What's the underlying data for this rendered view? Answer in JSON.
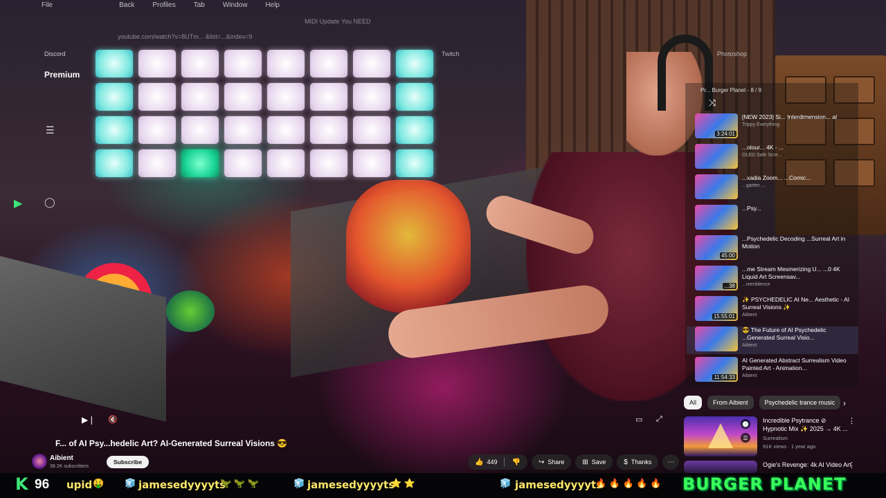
{
  "app_menu": {
    "file": "File",
    "back": "Back",
    "profiles": "Profiles",
    "tab": "Tab",
    "window": "Window",
    "help": "Help"
  },
  "ghost": {
    "url": "youtube.com/watch?v=8UTm... &list=...&index=9",
    "tab_text": "MIDI Update You NEED",
    "discord": "Discord",
    "premium": "Premium",
    "twitch": "Twitch",
    "photoshop": "Photoshop"
  },
  "pads": [
    [
      "cyan",
      "white",
      "white",
      "white",
      "white",
      "white",
      "white",
      "cyan"
    ],
    [
      "cyan",
      "white",
      "white",
      "white",
      "white",
      "white",
      "white",
      "cyan"
    ],
    [
      "cyan",
      "white",
      "white",
      "white",
      "white",
      "white",
      "white",
      "cyan"
    ],
    [
      "cyan",
      "white",
      "green",
      "white",
      "white",
      "white",
      "white",
      "cyan"
    ]
  ],
  "playlist": {
    "header": "Pr... Burger Planet - 8 / 9",
    "items": [
      {
        "title": "[NEW 2023] Si... Interdimension... al",
        "channel": "Trippy Everything",
        "duration": "3:24:01",
        "active": false
      },
      {
        "title": "...olour... 4K - ...",
        "channel": "OLED Safe Scre...",
        "duration": "",
        "active": false
      },
      {
        "title": "...xadia Zoom... ...Comic...",
        "channel": "...garten ...",
        "duration": "",
        "active": false
      },
      {
        "title": "...Psy...",
        "channel": "",
        "duration": "",
        "active": false
      },
      {
        "title": "...Psychedelic Decoding ...Surreal Art in Motion",
        "channel": "",
        "duration": "45:00",
        "active": false
      },
      {
        "title": "...me Stream Mesmerizing U... ...0 4K Liquid Art Screensav...",
        "channel": "...reenblence",
        "duration": "...38",
        "active": false
      },
      {
        "title": "✨ PSYCHEDELIC AI Ne... Aesthetic - AI Surreal Visions ✨",
        "channel": "Aibient",
        "duration": "15:55:01",
        "active": false
      },
      {
        "title": "😎 The Future of AI Psychedelic ...Generated Surreal Visio...",
        "channel": "Aibient",
        "duration": "",
        "active": true
      },
      {
        "title": "AI Generated Abstract Surrealism Video Painted Art - Animation...",
        "channel": "Aibient",
        "duration": "11:54:33",
        "active": false
      }
    ]
  },
  "chips": {
    "all": "All",
    "from_channel": "From Aibient",
    "genre": "Psychedelic trance music"
  },
  "recommendations": [
    {
      "title": "Incredible Psytrance ⊘ Hypnotic Mix ✨ 2025 → 4K ...",
      "channel": "Surrealism",
      "stats": "91K views · 1 year ago"
    },
    {
      "title": "Ogie's Revenge: 4k AI Video Art",
      "channel": "",
      "stats": ""
    }
  ],
  "video": {
    "title": "F... of AI Psy...hedelic Art? AI-Generated Surreal Visions 😎",
    "channel": "Aibient",
    "subscribers": "38.2K subscribers",
    "subscribe_label": "Subscribe",
    "likes": "449",
    "share": "Share",
    "save": "Save",
    "thanks": "Thanks"
  },
  "ticker": {
    "k": "K",
    "count": "96",
    "fragment": "upid",
    "user1": "jamesedyyyyts",
    "user2": "jamesedyyyyts",
    "user3": "jamesedyyyyts",
    "emoji1": "🦖 🦖 🦖",
    "emoji2": "⭐ ⭐",
    "emoji3": "🔥 🔥 🔥 🔥 🔥",
    "brand": "BURGER PLANET"
  },
  "colors": {
    "pad_cyan": "#7de8e0",
    "pad_green": "#1ed79a",
    "brand_green": "#39ff5a",
    "ticker_yellow": "#ffe86a"
  }
}
